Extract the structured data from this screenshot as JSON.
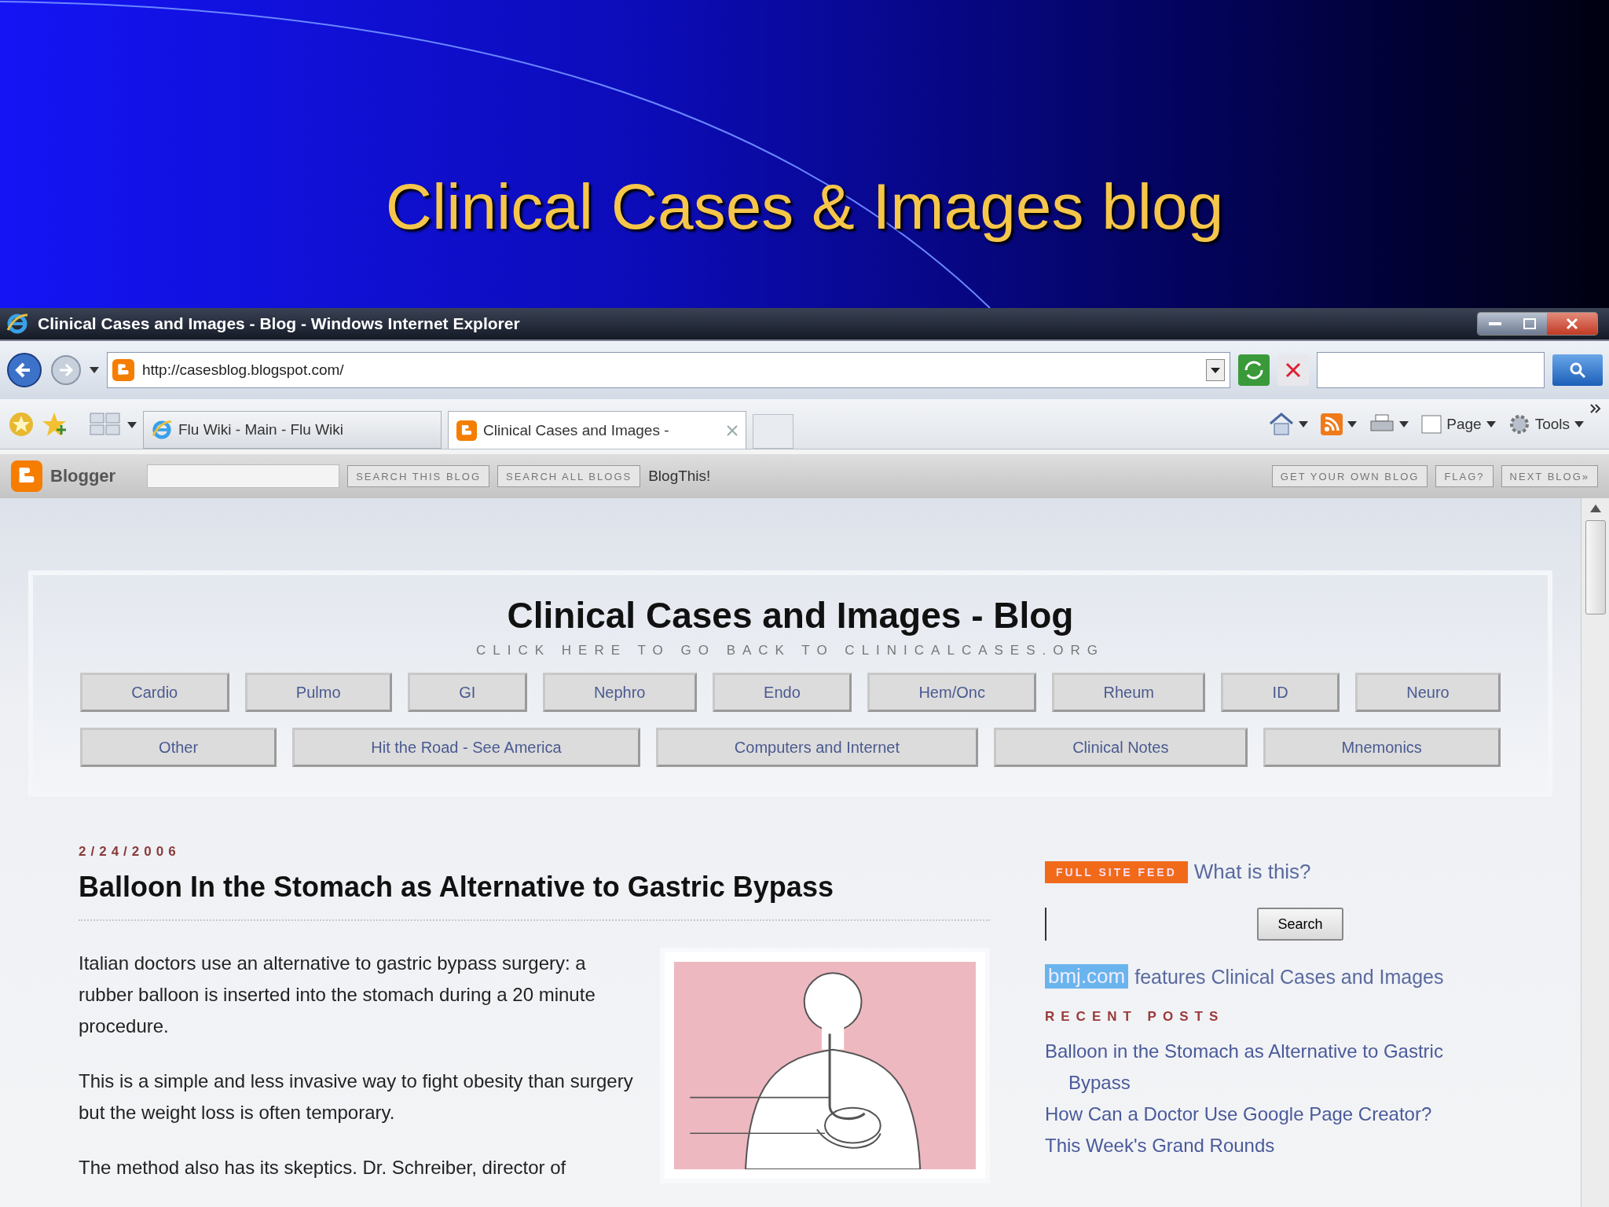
{
  "slide": {
    "title": "Clinical Cases & Images blog"
  },
  "browser": {
    "title": "Clinical Cases and Images - Blog - Windows Internet Explorer",
    "address": "http://casesblog.blogspot.com/",
    "tabs": [
      {
        "label": "Flu Wiki - Main - Flu Wiki",
        "selected": false
      },
      {
        "label": "Clinical Cases and Images -",
        "selected": true
      }
    ],
    "toolbar": [
      "Page",
      "Tools"
    ]
  },
  "blogger_bar": {
    "brand": "Blogger",
    "buttons_left": [
      "SEARCH THIS BLOG",
      "SEARCH ALL BLOGS"
    ],
    "blog_this": "BlogThis!",
    "buttons_right": [
      "GET YOUR OWN BLOG",
      "FLAG?",
      "NEXT BLOG»"
    ]
  },
  "blog": {
    "title": "Clinical Cases and Images - Blog",
    "subtitle": "CLICK HERE TO GO BACK TO CLINICALCASES.ORG",
    "nav_rows": [
      [
        "Cardio",
        "Pulmo",
        "GI",
        "Nephro",
        "Endo",
        "Hem/Onc",
        "Rheum",
        "ID",
        "Neuro"
      ],
      [
        "Other",
        "Hit the Road - See America",
        "Computers and Internet",
        "Clinical Notes",
        "Mnemonics"
      ]
    ]
  },
  "post": {
    "date": "2/24/2006",
    "title": "Balloon In the Stomach as Alternative to Gastric Bypass",
    "paragraphs": [
      "Italian doctors use an alternative to gastric bypass surgery: a rubber balloon is inserted into the stomach during a 20 minute procedure.",
      "This is a simple and less invasive way to fight obesity than surgery but the weight loss is often temporary.",
      "The method also has its skeptics. Dr. Schreiber, director of"
    ]
  },
  "sidebar": {
    "feed_badge": "FULL SITE FEED",
    "feed_link": "What is this?",
    "search_button": "Search",
    "bmj_badge": "bmj.com",
    "bmj_text": "features Clinical Cases and Images",
    "recent_heading": "RECENT POSTS",
    "recent_posts": [
      "Balloon in the Stomach as Alternative to Gastric Bypass",
      "How Can a Doctor Use Google Page Creator?",
      "This Week's Grand Rounds"
    ]
  }
}
